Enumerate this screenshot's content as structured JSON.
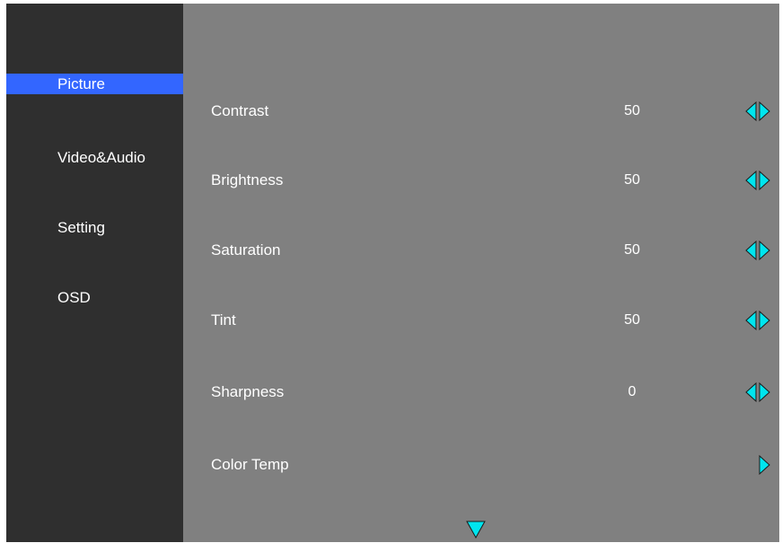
{
  "sidebar": {
    "items": [
      {
        "label": "Picture",
        "active": true
      },
      {
        "label": "Video&Audio",
        "active": false
      },
      {
        "label": "Setting",
        "active": false
      },
      {
        "label": "OSD",
        "active": false
      }
    ]
  },
  "menu": {
    "items": [
      {
        "label": "Contrast",
        "value": "50",
        "control": "left-right-arrows-icon"
      },
      {
        "label": "Brightness",
        "value": "50",
        "control": "left-right-arrows-icon"
      },
      {
        "label": "Saturation",
        "value": "50",
        "control": "left-right-arrows-icon"
      },
      {
        "label": "Tint",
        "value": "50",
        "control": "left-right-arrows-icon"
      },
      {
        "label": "Sharpness",
        "value": "0",
        "control": "left-right-arrows-icon"
      },
      {
        "label": "Color Temp",
        "value": "",
        "control": "right-arrow-icon"
      }
    ]
  },
  "scroll": {
    "icon": "down-arrow-icon"
  },
  "colors": {
    "sidebar_bg": "#2f2f2f",
    "content_bg": "#808080",
    "highlight": "#3366ff",
    "arrow_fill": "#00e5ee"
  }
}
